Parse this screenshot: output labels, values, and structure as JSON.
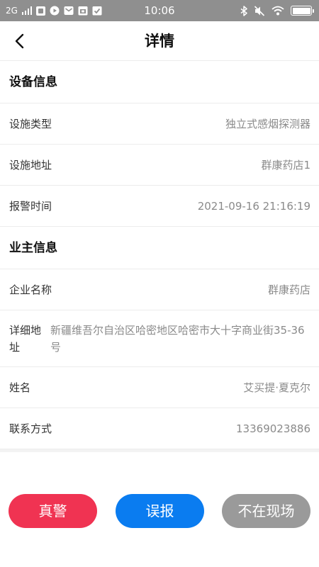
{
  "status_bar": {
    "network": "2G",
    "time": "10:06",
    "battery_level": 1.0,
    "icons": [
      "signal-icon",
      "notification-icon",
      "video-icon",
      "mail-icon",
      "calendar-icon",
      "checklist-icon",
      "bluetooth-icon",
      "mute-icon",
      "wifi-icon",
      "battery-icon"
    ]
  },
  "header": {
    "title": "详情",
    "back_icon": "chevron-left-icon"
  },
  "device_section": {
    "title": "设备信息",
    "rows": [
      {
        "label": "设施类型",
        "value": "独立式感烟探测器"
      },
      {
        "label": "设施地址",
        "value": "群康药店1"
      },
      {
        "label": "报警时间",
        "value": "2021-09-16 21:16:19"
      }
    ]
  },
  "owner_section": {
    "title": "业主信息",
    "rows": [
      {
        "label": "企业名称",
        "value": "群康药店"
      },
      {
        "label": "详细地址",
        "value": "新疆维吾尔自治区哈密地区哈密市大十字商业街35-36号"
      },
      {
        "label": "姓名",
        "value": "艾买提·夏克尔"
      },
      {
        "label": "联系方式",
        "value": "13369023886"
      }
    ]
  },
  "actions": {
    "real_alarm": "真警",
    "false_alarm": "误报",
    "not_on_site": "不在现场"
  },
  "colors": {
    "status_bar_bg": "#8f8f8f",
    "real_alarm": "#f03352",
    "false_alarm": "#0a7cf0",
    "not_on_site": "#9a9a9a",
    "value_text": "#8a8a8a"
  }
}
